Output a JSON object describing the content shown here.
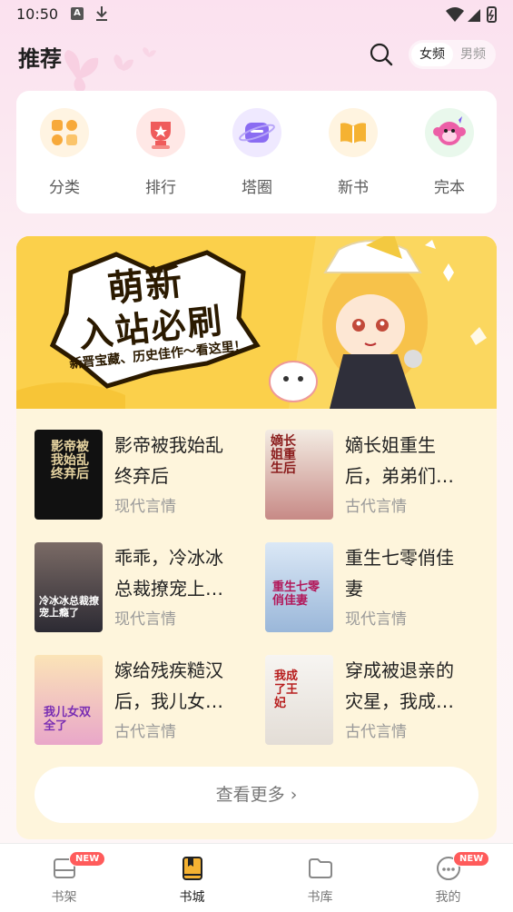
{
  "status_bar": {
    "time": "10:50",
    "a_icon": "A"
  },
  "header": {
    "title": "推荐",
    "search_icon": "search-icon",
    "gender_female": "女频",
    "gender_male": "男频"
  },
  "categories": [
    {
      "label": "分类",
      "icon": "grid-icon",
      "color": "#f7a93a"
    },
    {
      "label": "排行",
      "icon": "trophy-icon",
      "color": "#ef5b5b"
    },
    {
      "label": "塔圈",
      "icon": "planet-icon",
      "color": "#8a6cf2"
    },
    {
      "label": "新书",
      "icon": "book-open-icon",
      "color": "#f5b232"
    },
    {
      "label": "完本",
      "icon": "monkey-icon",
      "color": "#ec5fa7"
    }
  ],
  "banner": {
    "line1": "萌新",
    "line2": "入站必刷",
    "subtitle": "新晋宝藏、历史佳作～看这里！"
  },
  "books": [
    {
      "title": "影帝被我始乱终弃后",
      "display": "影帝被我始乱\n终弃后",
      "genre": "现代言情",
      "cover_text": "影帝被我始乱终弃后"
    },
    {
      "title": "嫡长姐重生后，弟弟们…",
      "display": "嫡长姐重生\n后，弟弟们…",
      "genre": "古代言情",
      "cover_text": "嫡长姐重生后"
    },
    {
      "title": "乖乖，冷冰冰总裁撩宠上…",
      "display": "乖乖，冷冰冰\n总裁撩宠上…",
      "genre": "现代言情",
      "cover_text": "冷冰冰总裁撩宠上瘾了"
    },
    {
      "title": "重生七零俏佳妻",
      "display": "重生七零俏佳\n妻",
      "genre": "现代言情",
      "cover_text": "重生七零俏佳妻"
    },
    {
      "title": "嫁给残疾糙汉后，我儿女…",
      "display": "嫁给残疾糙汉\n后，我儿女…",
      "genre": "古代言情",
      "cover_text": "我儿女双全了"
    },
    {
      "title": "穿成被退亲的灾星，我成…",
      "display": "穿成被退亲的\n灾星，我成…",
      "genre": "古代言情",
      "cover_text": "我成了王妃"
    }
  ],
  "more_button": "查看更多 ›",
  "bottom_nav": [
    {
      "label": "书架",
      "icon": "bookshelf-icon",
      "badge": "NEW"
    },
    {
      "label": "书城",
      "icon": "bookstore-icon",
      "badge": ""
    },
    {
      "label": "书库",
      "icon": "folder-icon",
      "badge": ""
    },
    {
      "label": "我的",
      "icon": "profile-icon",
      "badge": "NEW"
    }
  ],
  "colors": {
    "accent": "#fbd04b",
    "badge": "#ff5b5b",
    "active_nav": "#f5b232"
  }
}
